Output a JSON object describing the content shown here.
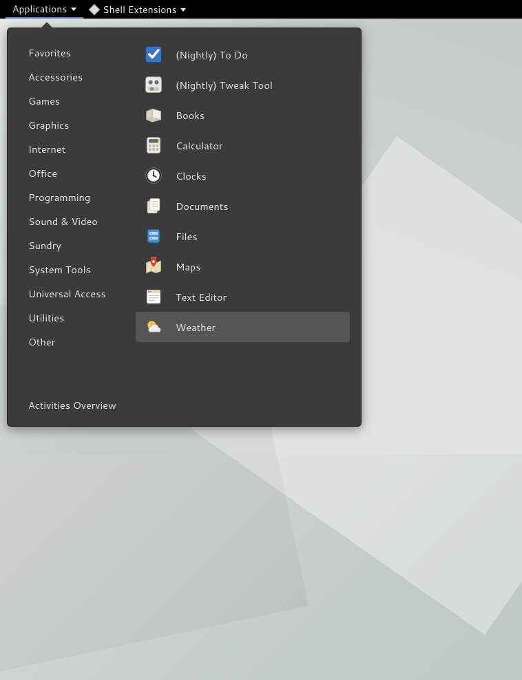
{
  "topbar": {
    "applications_label": "Applications",
    "shell_extensions_label": "Shell Extensions"
  },
  "menu": {
    "categories": [
      "Favorites",
      "Accessories",
      "Games",
      "Graphics",
      "Internet",
      "Office",
      "Programming",
      "Sound & Video",
      "Sundry",
      "System Tools",
      "Universal Access",
      "Utilities",
      "Other"
    ],
    "apps": [
      {
        "label": "(Nightly) To Do",
        "icon": "todo",
        "hovered": false
      },
      {
        "label": "(Nightly) Tweak Tool",
        "icon": "tweak",
        "hovered": false
      },
      {
        "label": "Books",
        "icon": "books",
        "hovered": false
      },
      {
        "label": "Calculator",
        "icon": "calculator",
        "hovered": false
      },
      {
        "label": "Clocks",
        "icon": "clocks",
        "hovered": false
      },
      {
        "label": "Documents",
        "icon": "documents",
        "hovered": false
      },
      {
        "label": "Files",
        "icon": "files",
        "hovered": false
      },
      {
        "label": "Maps",
        "icon": "maps",
        "hovered": false
      },
      {
        "label": "Text Editor",
        "icon": "texteditor",
        "hovered": false
      },
      {
        "label": "Weather",
        "icon": "weather",
        "hovered": true
      }
    ],
    "activities_label": "Activities Overview"
  }
}
